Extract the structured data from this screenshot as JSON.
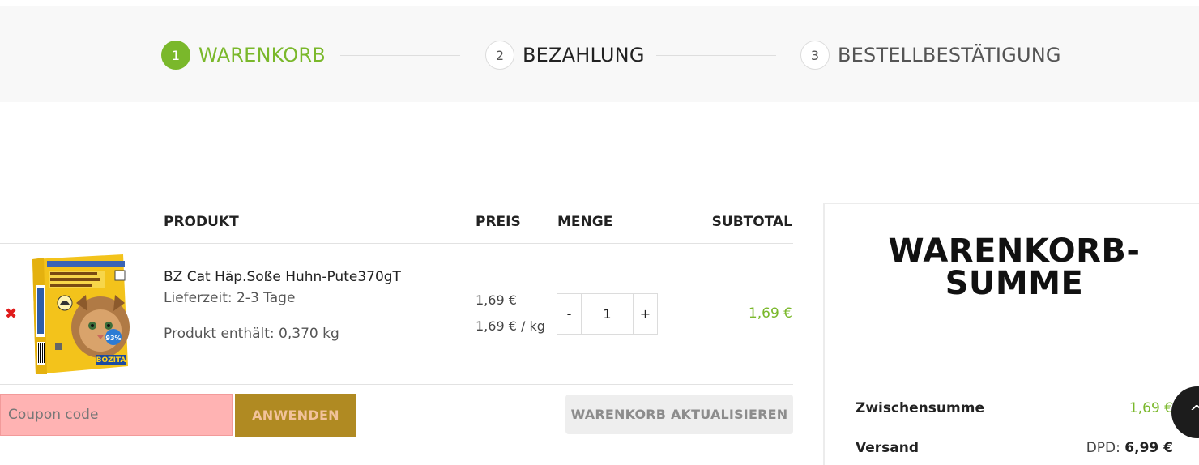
{
  "steps": [
    {
      "number": "1",
      "label": "WARENKORB"
    },
    {
      "number": "2",
      "label": "BEZAHLUNG"
    },
    {
      "number": "3",
      "label": "BESTELLBESTÄTIGUNG"
    }
  ],
  "cart": {
    "headers": {
      "product": "PRODUKT",
      "price": "PREIS",
      "quantity": "MENGE",
      "subtotal": "SUBTOTAL"
    },
    "items": [
      {
        "remove_icon": "✖",
        "name": "BZ Cat Häp.Soße Huhn-Pute370gT",
        "delivery": "Lieferzeit: 2-3 Tage",
        "content": "Produkt enthält: 0,370 kg",
        "price": "1,69 €",
        "unit_price": "1,69 € / kg",
        "quantity": "1",
        "minus_label": "-",
        "plus_label": "+",
        "subtotal": "1,69 €"
      }
    ],
    "coupon": {
      "placeholder": "Coupon code",
      "apply_label": "ANWENDEN"
    },
    "update_label": "WARENKORB AKTUALISIEREN"
  },
  "totals": {
    "title_line1": "WARENKORB-",
    "title_line2": "SUMME",
    "subtotal_label": "Zwischensumme",
    "subtotal_value": "1,69 €",
    "shipping_label": "Versand",
    "shipping_carrier": "DPD: ",
    "shipping_value": "6,99 €"
  },
  "product_image": {
    "brand": "BOZITA",
    "badge": "93%"
  },
  "colors": {
    "accent": "#7ab82b",
    "apply_button": "#b08a22",
    "coupon_bg": "#ffb3b3"
  }
}
